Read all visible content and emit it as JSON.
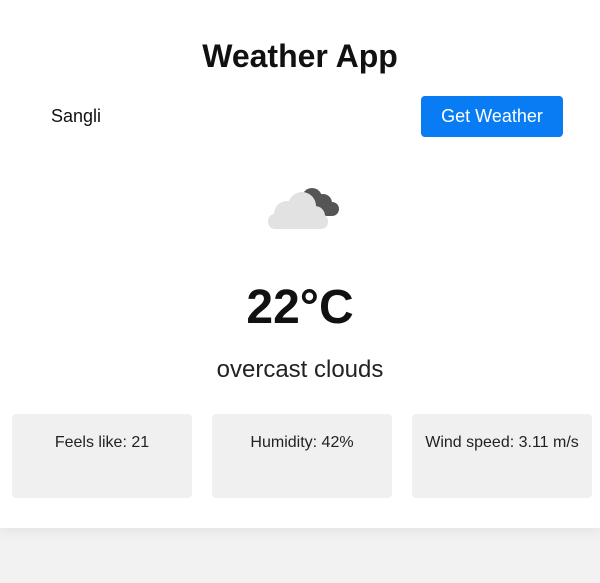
{
  "app": {
    "title": "Weather App"
  },
  "search": {
    "city_value": "Sangli",
    "button_label": "Get Weather"
  },
  "weather": {
    "icon": "overcast-clouds-icon",
    "temperature": "22°C",
    "description": "overcast clouds"
  },
  "stats": {
    "feels_like": "Feels like: 21",
    "humidity": "Humidity: 42%",
    "wind_speed": "Wind speed: 3.11 m/s"
  },
  "colors": {
    "accent": "#0a7cf3",
    "card_bg": "#ffffff",
    "stat_bg": "#f0f0f0",
    "page_bg": "#f2f2f2"
  }
}
